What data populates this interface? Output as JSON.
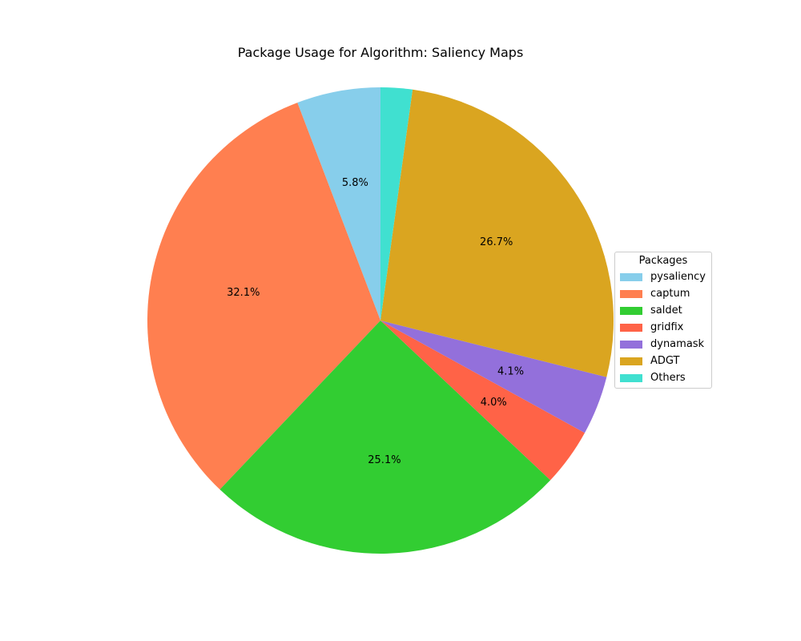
{
  "chart_data": {
    "type": "pie",
    "title": "Package Usage for Algorithm: Saliency Maps",
    "legend_title": "Packages",
    "legend_placement": "center-right",
    "start_angle_deg": 90,
    "direction": "counterclockwise",
    "slices": [
      {
        "label": "pysaliency",
        "value": 5.8,
        "pct_label": "5.8%",
        "color": "#87CEEB"
      },
      {
        "label": "captum",
        "value": 32.1,
        "pct_label": "32.1%",
        "color": "#FF7F50"
      },
      {
        "label": "saldet",
        "value": 25.1,
        "pct_label": "25.1%",
        "color": "#32CD32"
      },
      {
        "label": "gridfix",
        "value": 4.0,
        "pct_label": "4.0%",
        "color": "#FF6347"
      },
      {
        "label": "dynamask",
        "value": 4.1,
        "pct_label": "4.1%",
        "color": "#9370DB"
      },
      {
        "label": "ADGT",
        "value": 26.7,
        "pct_label": "26.7%",
        "color": "#DAA520"
      },
      {
        "label": "Others",
        "value": 2.2,
        "pct_label": "",
        "color": "#40E0D0"
      }
    ]
  }
}
